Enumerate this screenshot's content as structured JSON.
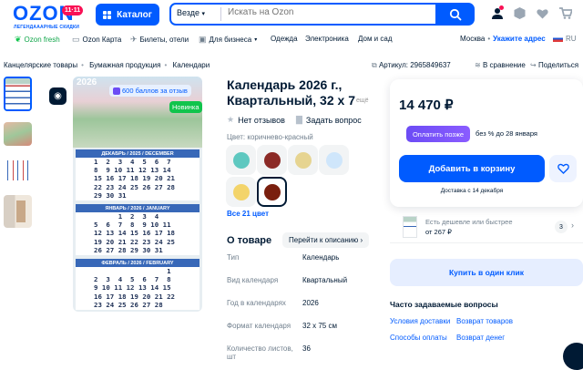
{
  "header": {
    "logo_text": "OZON",
    "logo_badge": "11·11",
    "logo_sub": "ЛЕГЕНДАААРНЫЕ СКИДКИ",
    "catalog_label": "Каталог",
    "search_scope": "Везде",
    "search_placeholder": "Искать на Ozon",
    "icons": [
      "profile-icon",
      "orders-icon",
      "favorites-icon",
      "cart-icon"
    ],
    "accent": "#005bff"
  },
  "subnav": {
    "items": [
      "Ozon fresh",
      "Ozon Карта",
      "Билеты, отели",
      "Для бизнеса",
      "Одежда",
      "Электроника",
      "Дом и сад"
    ],
    "city": "Москва",
    "address": "Укажите адрес",
    "lang": "RU"
  },
  "breadcrumb": {
    "items": [
      "Канцелярские товары",
      "Бумажная продукция",
      "Календари"
    ],
    "article": "Артикул: 2965849637",
    "compare": "В сравнение",
    "share": "Поделиться"
  },
  "gallery": {
    "year": "2026",
    "points_badge": "600 баллов за отзыв",
    "new_badge": "Новинка",
    "months": [
      {
        "title": "ДЕКАБРЬ / 2025 / DECEMBER",
        "rows": [
          "1  2  3  4  5  6  7",
          "8  9 10 11 12 13 14",
          "15 16 17 18 19 20 21",
          "22 23 24 25 26 27 28",
          "29 30 31"
        ]
      },
      {
        "title": "ЯНВАРЬ / 2026 / JANUARY",
        "rows": [
          "      1  2  3  4",
          "5  6  7  8  9 10 11",
          "12 13 14 15 16 17 18",
          "19 20 21 22 23 24 25",
          "26 27 28 29 30 31"
        ]
      },
      {
        "title": "ФЕВРАЛЬ / 2026 / FEBRUARY",
        "rows": [
          "                  1",
          "2  3  4  5  6  7  8",
          "9 10 11 12 13 14 15",
          "16 17 18 19 20 21 22",
          "23 24 25 26 27 28"
        ]
      }
    ]
  },
  "product": {
    "title": "Календарь 2026 г., Квартальный, 32 х 7",
    "title_more": "ещё",
    "reviews": "Нет отзывов",
    "ask": "Задать вопрос",
    "color_label": "Цвет: коричнево-красный",
    "swatches": [
      "#5ec8c0",
      "#8b2a26",
      "#e6d491",
      "#cfe6fb",
      "#f3d46a",
      "#7a1f0e"
    ],
    "all_colors": "Все 21 цвет",
    "about_title": "О товаре",
    "to_description": "Перейти к описанию",
    "specs": [
      {
        "k": "Тип",
        "v": "Календарь"
      },
      {
        "k": "Вид календаря",
        "v": "Квартальный"
      },
      {
        "k": "Год в календарях",
        "v": "2026"
      },
      {
        "k": "Формат календаря",
        "v": "32 x 75 см"
      },
      {
        "k": "Количество листов, шт",
        "v": "36"
      }
    ]
  },
  "buy": {
    "price": "14 470 ₽",
    "pay_later": "Оплатить позже",
    "pay_later_text": "без % до 28 января",
    "add_to_cart": "Добавить в корзину",
    "delivery": "Доставка с 14 декабря",
    "cheaper_title": "Есть дешевле или быстрее",
    "cheaper_price": "от 267 ₽",
    "cheaper_count": "3",
    "one_click": "Купить в один клик",
    "faq_title": "Часто задаваемые вопросы",
    "faq_links": [
      "Условия доставки",
      "Возврат товаров",
      "Способы оплаты",
      "Возврат денег"
    ]
  }
}
